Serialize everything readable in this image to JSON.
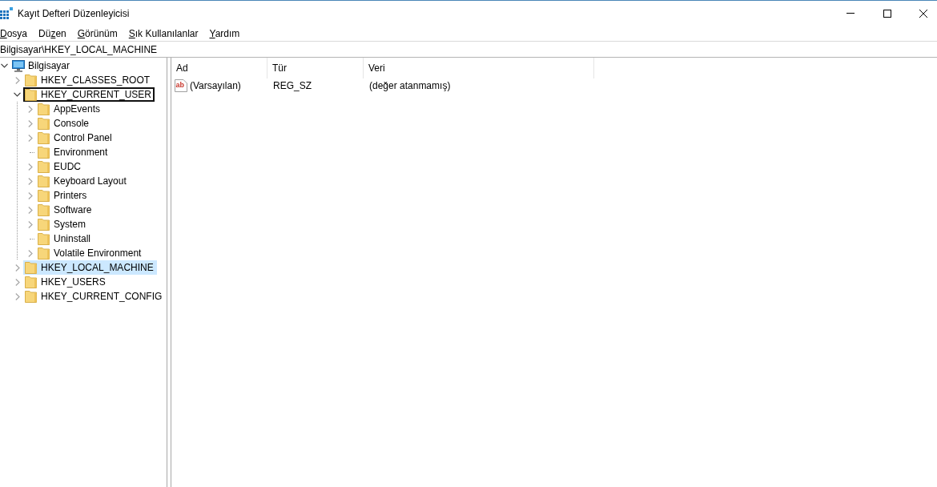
{
  "window": {
    "title": "Kayıt Defteri Düzenleyicisi"
  },
  "menu": [
    {
      "key": "D",
      "after": "osya"
    },
    {
      "before": "Dü",
      "key": "z",
      "after": "en"
    },
    {
      "key": "G",
      "after": "örünüm"
    },
    {
      "key": "S",
      "after": "ık Kullanılanlar"
    },
    {
      "key": "Y",
      "after": "ardım"
    }
  ],
  "address_bar": {
    "value": "Bilgisayar\\HKEY_LOCAL_MACHINE"
  },
  "tree": [
    {
      "kind": "computer",
      "label": "Bilgisayar",
      "expandable": true,
      "expanded": true,
      "selected": false,
      "focused": false,
      "children": [
        {
          "kind": "folder",
          "label": "HKEY_CLASSES_ROOT",
          "expandable": true,
          "expanded": false,
          "selected": false,
          "focused": false
        },
        {
          "kind": "folder",
          "label": "HKEY_CURRENT_USER",
          "expandable": true,
          "expanded": true,
          "selected": false,
          "focused": true,
          "children": [
            {
              "kind": "folder",
              "label": "AppEvents",
              "expandable": true,
              "expanded": false,
              "selected": false,
              "focused": false
            },
            {
              "kind": "folder",
              "label": "Console",
              "expandable": true,
              "expanded": false,
              "selected": false,
              "focused": false
            },
            {
              "kind": "folder",
              "label": "Control Panel",
              "expandable": true,
              "expanded": false,
              "selected": false,
              "focused": false
            },
            {
              "kind": "folder",
              "label": "Environment",
              "expandable": false,
              "selected": false,
              "focused": false
            },
            {
              "kind": "folder",
              "label": "EUDC",
              "expandable": true,
              "expanded": false,
              "selected": false,
              "focused": false
            },
            {
              "kind": "folder",
              "label": "Keyboard Layout",
              "expandable": true,
              "expanded": false,
              "selected": false,
              "focused": false
            },
            {
              "kind": "folder",
              "label": "Printers",
              "expandable": true,
              "expanded": false,
              "selected": false,
              "focused": false
            },
            {
              "kind": "folder",
              "label": "Software",
              "expandable": true,
              "expanded": false,
              "selected": false,
              "focused": false
            },
            {
              "kind": "folder",
              "label": "System",
              "expandable": true,
              "expanded": false,
              "selected": false,
              "focused": false
            },
            {
              "kind": "folder",
              "label": "Uninstall",
              "expandable": false,
              "selected": false,
              "focused": false
            },
            {
              "kind": "folder",
              "label": "Volatile Environment",
              "expandable": true,
              "expanded": false,
              "selected": false,
              "focused": false
            }
          ]
        },
        {
          "kind": "folder",
          "label": "HKEY_LOCAL_MACHINE",
          "expandable": true,
          "expanded": false,
          "selected": true,
          "focused": false
        },
        {
          "kind": "folder",
          "label": "HKEY_USERS",
          "expandable": true,
          "expanded": false,
          "selected": false,
          "focused": false
        },
        {
          "kind": "folder",
          "label": "HKEY_CURRENT_CONFIG",
          "expandable": true,
          "expanded": false,
          "selected": false,
          "focused": false
        }
      ]
    }
  ],
  "list": {
    "columns": [
      {
        "label": "Ad"
      },
      {
        "label": "Tür"
      },
      {
        "label": "Veri"
      }
    ],
    "rows": [
      {
        "kind": "string",
        "icon_text": "ab",
        "name": "(Varsayılan)",
        "type": "REG_SZ",
        "data": "(değer atanmamış)"
      }
    ]
  }
}
